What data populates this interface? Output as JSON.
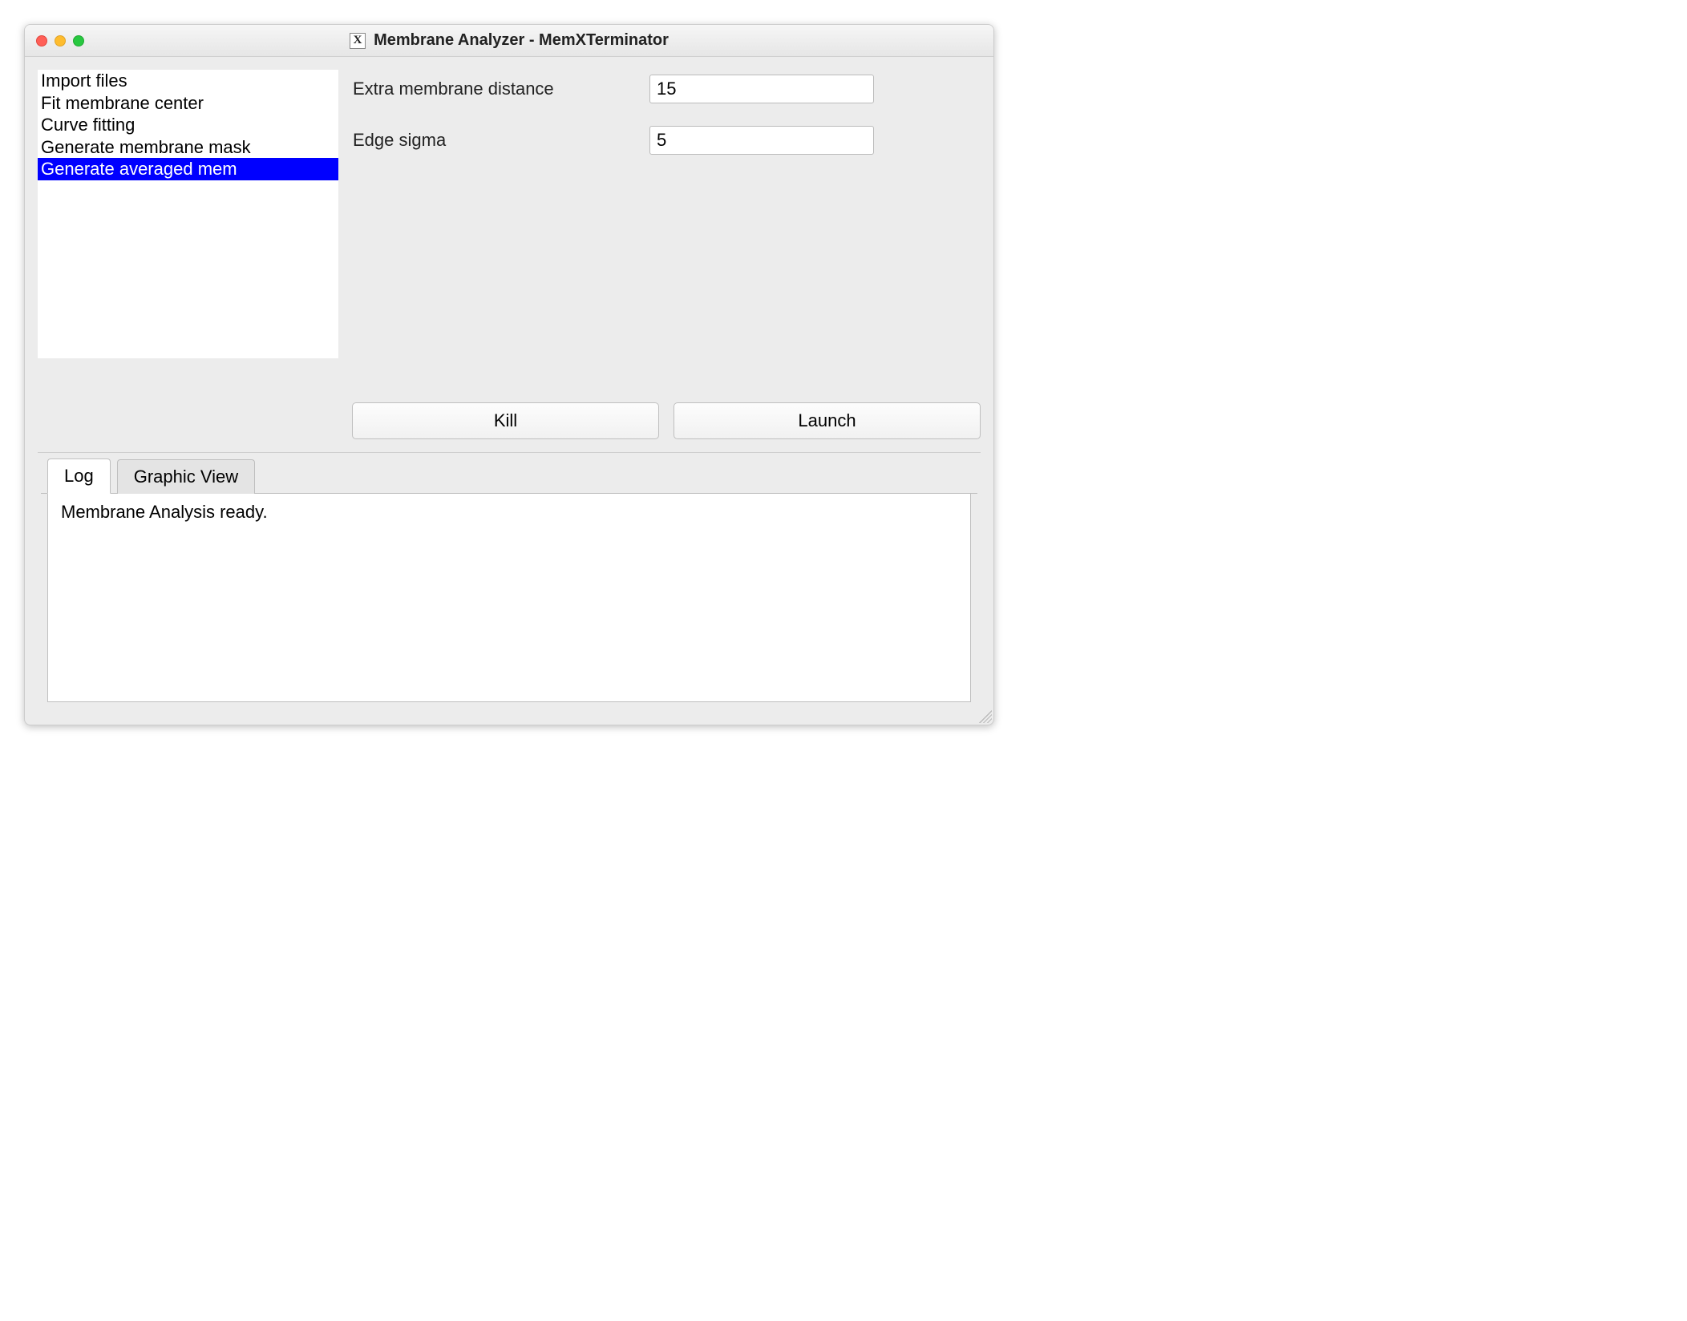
{
  "titlebar": {
    "icon_label": "X",
    "title": "Membrane Analyzer - MemXTerminator"
  },
  "sidebar": {
    "items": [
      {
        "label": "Import files",
        "selected": false
      },
      {
        "label": "Fit membrane center",
        "selected": false
      },
      {
        "label": "Curve fitting",
        "selected": false
      },
      {
        "label": "Generate membrane mask",
        "selected": false
      },
      {
        "label": "Generate averaged mem",
        "selected": true
      }
    ]
  },
  "form": {
    "fields": [
      {
        "label": "Extra membrane distance",
        "value": "15"
      },
      {
        "label": "Edge sigma",
        "value": "5"
      }
    ]
  },
  "buttons": {
    "kill": "Kill",
    "launch": "Launch"
  },
  "tabs": {
    "items": [
      {
        "label": "Log",
        "active": true
      },
      {
        "label": "Graphic View",
        "active": false
      }
    ],
    "log_content": "Membrane Analysis ready."
  }
}
